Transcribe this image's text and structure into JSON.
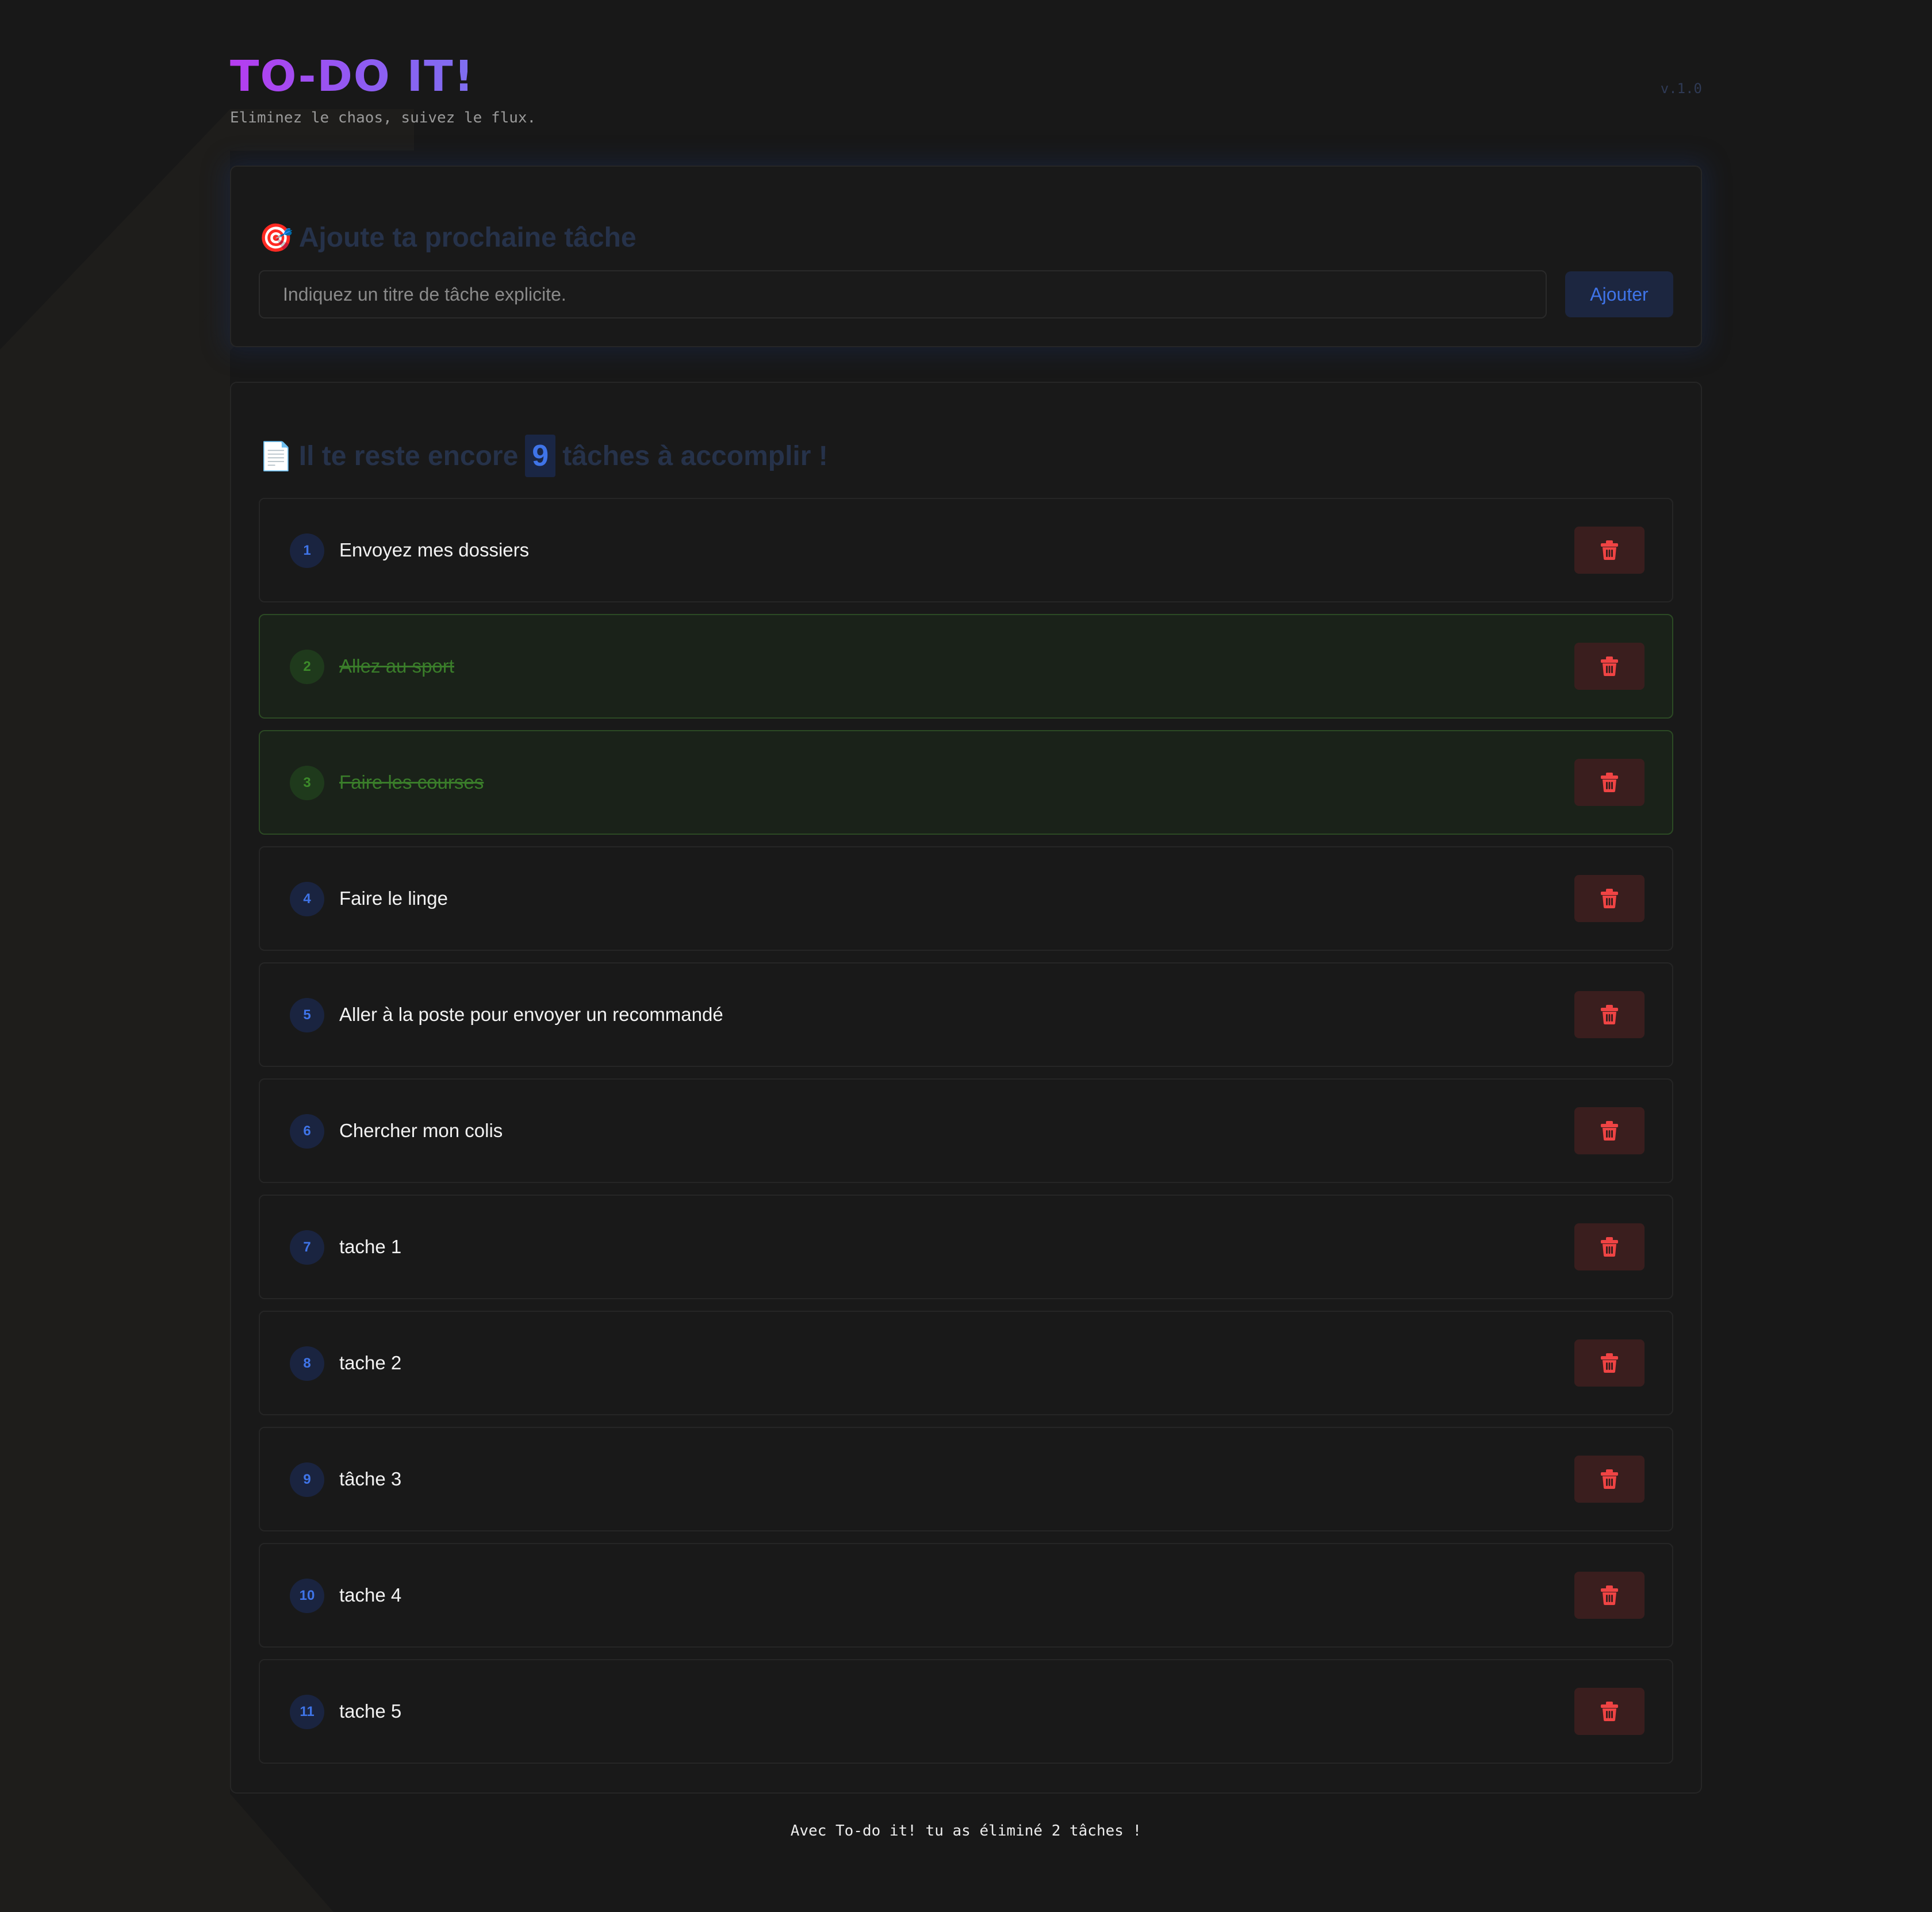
{
  "header": {
    "title": "TO-DO IT!",
    "tagline": "Eliminez le chaos, suivez le flux.",
    "version": "v.1.0"
  },
  "add_section": {
    "emoji": "🎯",
    "title": "Ajoute ta prochaine tâche",
    "input_placeholder": "Indiquez un titre de tâche explicite.",
    "input_value": "",
    "button_label": "Ajouter"
  },
  "list_section": {
    "emoji": "📄",
    "title_before": "Il te reste encore",
    "remaining_count": "9",
    "title_after": "tâches à accomplir !"
  },
  "tasks": [
    {
      "num": "1",
      "text": "Envoyez mes dossiers",
      "done": false
    },
    {
      "num": "2",
      "text": "Allez au sport",
      "done": true
    },
    {
      "num": "3",
      "text": "Faire les courses",
      "done": true
    },
    {
      "num": "4",
      "text": "Faire le linge",
      "done": false
    },
    {
      "num": "5",
      "text": "Aller à la poste pour envoyer un recommandé",
      "done": false
    },
    {
      "num": "6",
      "text": "Chercher mon colis",
      "done": false
    },
    {
      "num": "7",
      "text": "tache 1",
      "done": false
    },
    {
      "num": "8",
      "text": "tache 2",
      "done": false
    },
    {
      "num": "9",
      "text": "tâche 3",
      "done": false
    },
    {
      "num": "10",
      "text": "tache 4",
      "done": false
    },
    {
      "num": "11",
      "text": "tache 5",
      "done": false
    }
  ],
  "delete_icon": "trash-icon",
  "colors": {
    "accent": "#3f74e8",
    "done": "#3a7d2a",
    "danger": "#ef4444",
    "title_gradient_start": "#b63cf0",
    "title_gradient_end": "#7f6ff0"
  },
  "footer": {
    "text": "Avec To-do it! tu as éliminé 2 tâches !"
  }
}
